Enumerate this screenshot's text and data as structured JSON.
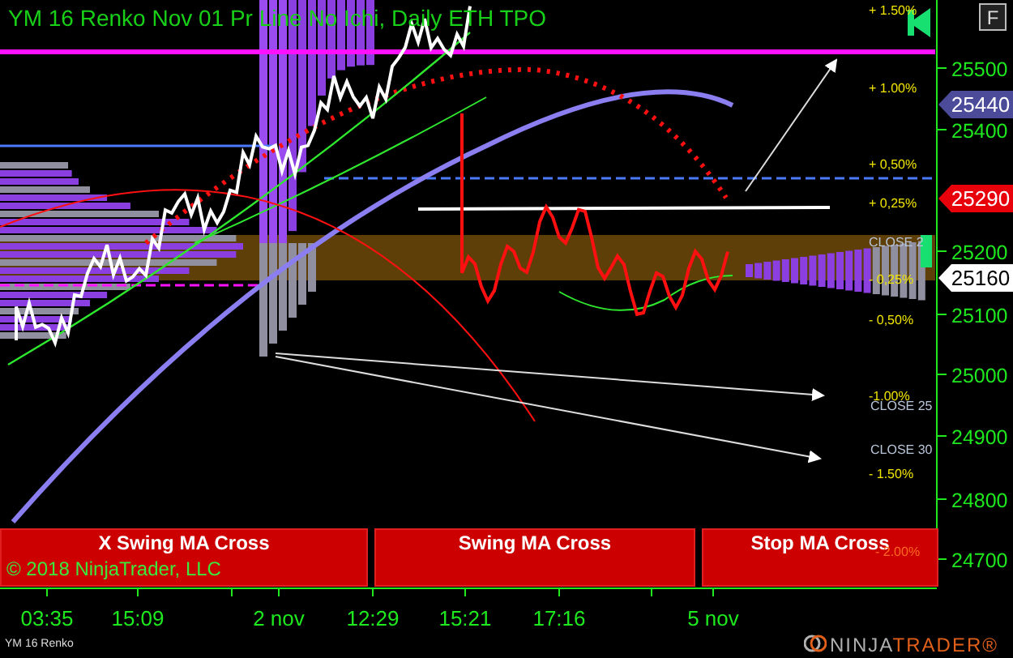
{
  "chart_title": "YM 16 Renko Nov 01  Pr Line No Ichi, Daily ETH TPO",
  "f_button": "F",
  "price_axis": {
    "labels": [
      "25500",
      "25400",
      "25200",
      "25100",
      "25000",
      "24900",
      "24800",
      "24700"
    ],
    "markers": [
      {
        "text": "25440",
        "color": "#4b4b9a"
      },
      {
        "text": "25290",
        "color": "#e8000b"
      },
      {
        "text": "25160",
        "color": "#ffffff"
      }
    ]
  },
  "percent_labels": [
    "+ 1.50%",
    "+ 1.00%",
    "+ 0,50%",
    "+ 0,25%",
    "- 0,25%",
    "- 0,50%",
    "-1.00%",
    "- 1.50%",
    "- 2.00%"
  ],
  "close_labels": [
    "CLOSE 2",
    "CLOSE 25",
    "CLOSE 30"
  ],
  "signal_buttons": [
    "X Swing MA Cross",
    "Swing MA Cross",
    "Stop MA Cross"
  ],
  "copyright": "© 2018 NinjaTrader, LLC",
  "time_axis": [
    "03:35",
    "15:09",
    "2 nov",
    "12:29",
    "15:21",
    "17:16",
    "5 nov"
  ],
  "footer": {
    "instrument": "YM 16 Renko",
    "logo_part_1": "NINJA",
    "logo_part_2": "TRADER®"
  }
}
